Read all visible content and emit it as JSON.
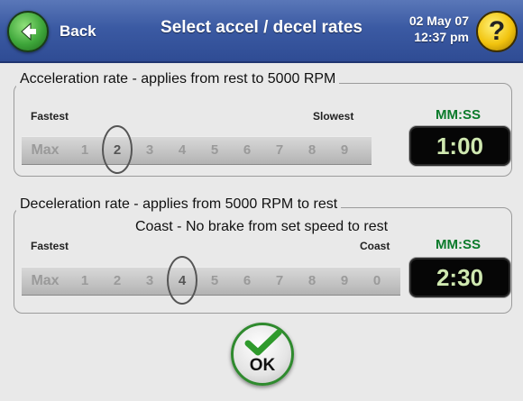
{
  "header": {
    "back_label": "Back",
    "title": "Select accel / decel rates",
    "date": "02 May 07",
    "time": "12:37 pm",
    "help_label": "?"
  },
  "acceleration": {
    "legend": "Acceleration rate - applies from rest to 5000 RPM",
    "left_label": "Fastest",
    "right_label": "Slowest",
    "time_label": "MM:SS",
    "time_value": "1:00",
    "options": [
      "Max",
      "1",
      "2",
      "3",
      "4",
      "5",
      "6",
      "7",
      "8",
      "9"
    ],
    "selected": "2"
  },
  "deceleration": {
    "legend": "Deceleration rate - applies from 5000 RPM to rest",
    "subline": "Coast - No brake from set speed to rest",
    "left_label": "Fastest",
    "right_label": "Coast",
    "time_label": "MM:SS",
    "time_value": "2:30",
    "options": [
      "Max",
      "1",
      "2",
      "3",
      "4",
      "5",
      "6",
      "7",
      "8",
      "9",
      "0"
    ],
    "selected": "4"
  },
  "ok_label": "OK",
  "colors": {
    "header": "#3b5aa3",
    "back_green": "#3ea63a",
    "help_yellow": "#f1c30e",
    "mmss_green": "#0a7a2a",
    "display_bg": "#060606"
  },
  "icons": {
    "back": "left-arrow-icon",
    "help": "question-icon",
    "ok": "checkmark-icon"
  }
}
